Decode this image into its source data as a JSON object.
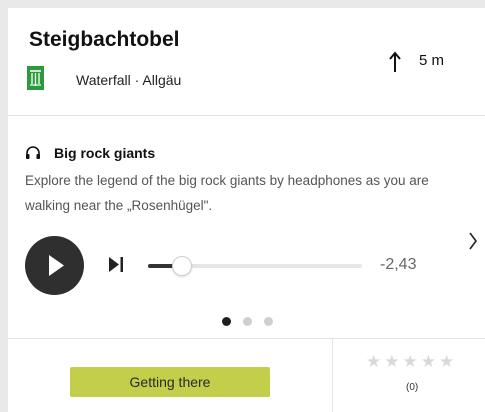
{
  "poi": {
    "title": "Steigbachtobel",
    "category": "Waterfall · Allgäu",
    "category_icon": "waterfall-icon",
    "category_color": "#2c9a3c",
    "distance": "5 m",
    "direction_icon": "arrow-up-icon"
  },
  "audio": {
    "title": "Big rock giants",
    "description": "Explore the legend of the big rock giants by headphones as you are walking near the „Rosenhügel\".",
    "time_remaining": "-2,43",
    "progress_percent": 16,
    "slide_count": 3,
    "active_slide": 0
  },
  "footer": {
    "getting_there_label": "Getting there",
    "getting_there_color": "#c3cf4a",
    "rating_stars": 0,
    "rating_max": 5,
    "rating_count": "(0)"
  }
}
